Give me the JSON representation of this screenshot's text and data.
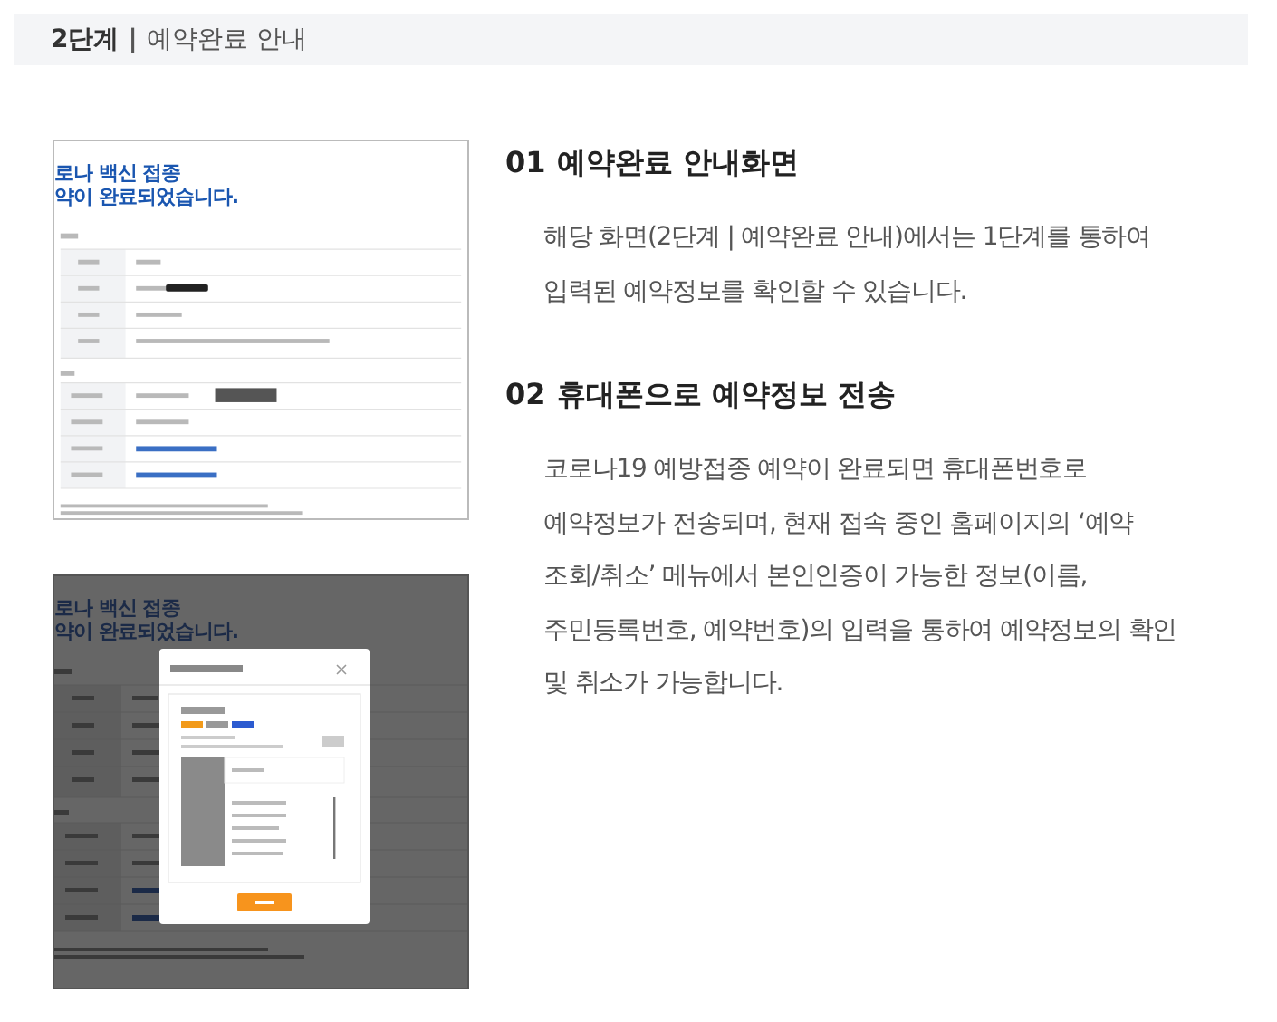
{
  "header": {
    "step": "2단계",
    "separator": "|",
    "title": "예약완료 안내"
  },
  "screenshots": [
    {
      "kind": "page",
      "headline": [
        "로나 백신 접종",
        "약이 완료되었습니다."
      ]
    },
    {
      "kind": "modal",
      "headline": [
        "로나 백신 접종",
        "약이 완료되었습니다."
      ]
    }
  ],
  "sections": [
    {
      "number": "01",
      "title": "예약완료 안내화면",
      "lines": [
        "해당 화면(2단계 | 예약완료 안내)에서는 1단계를 통하여",
        "입력된 예약정보를 확인할 수 있습니다."
      ]
    },
    {
      "number": "02",
      "title": "휴대폰으로 예약정보 전송",
      "lines": [
        "코로나19 예방접종 예약이 완료되면 휴대폰번호로",
        "예약정보가 전송되며, 현재 접속 중인 홈페이지의 ‘예약",
        "조회/취소’ 메뉴에서 본인인증이 가능한 정보(이름,",
        "주민등록번호, 예약번호)의 입력을 통하여 예약정보의 확인",
        "및 취소가 가능합니다."
      ]
    }
  ]
}
